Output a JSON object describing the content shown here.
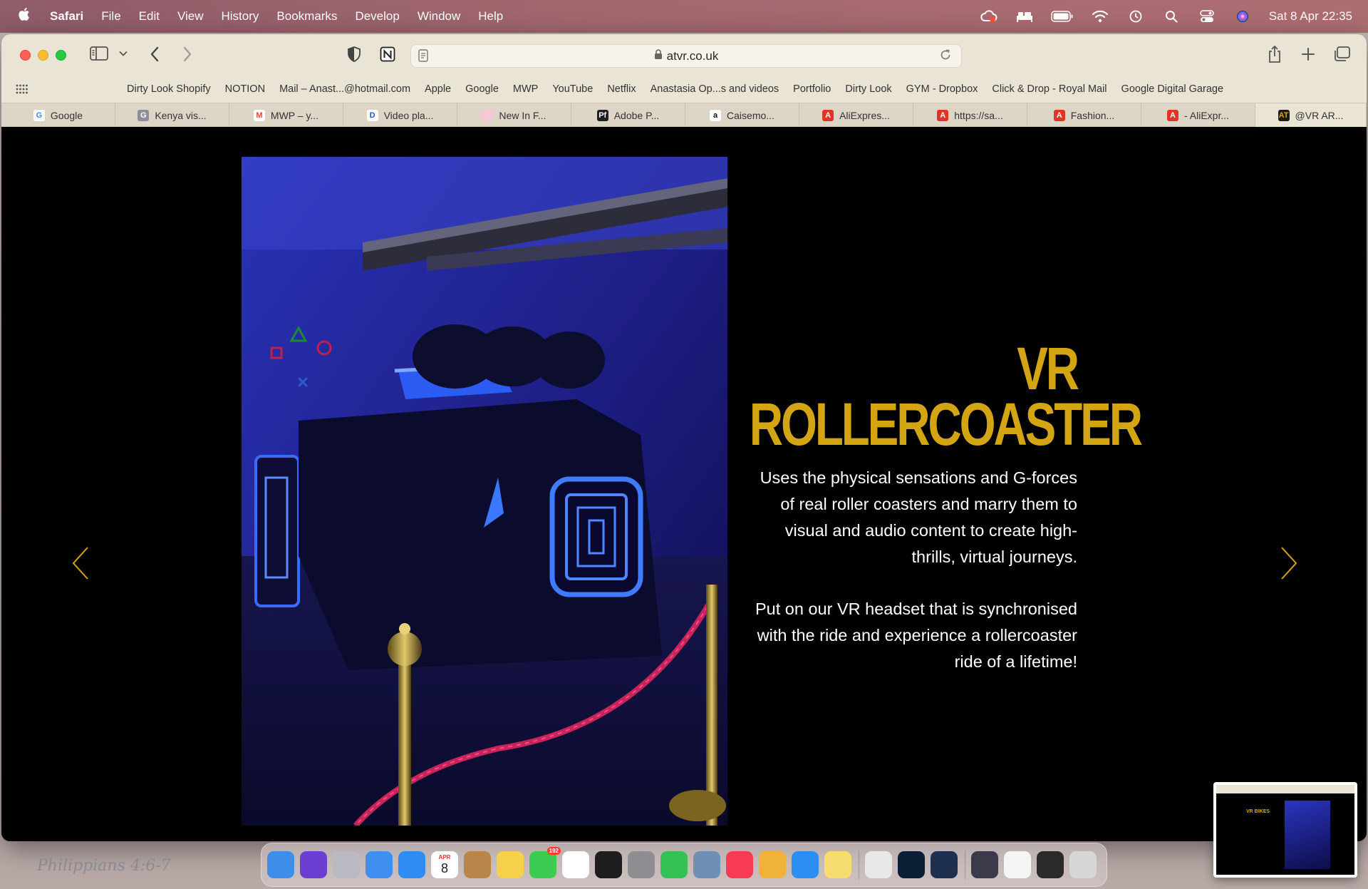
{
  "menubar": {
    "app_name": "Safari",
    "items": [
      "File",
      "Edit",
      "View",
      "History",
      "Bookmarks",
      "Develop",
      "Window",
      "Help"
    ],
    "clock": "Sat 8 Apr  22:35"
  },
  "toolbar": {
    "url": "atvr.co.uk"
  },
  "favorites": [
    "Dirty Look Shopify",
    "NOTION",
    "Mail – Anast...@hotmail.com",
    "Apple",
    "Google",
    "MWP",
    "YouTube",
    "Netflix",
    "Anastasia Op...s and videos",
    "Portfolio",
    "Dirty Look",
    "GYM - Dropbox",
    "Click & Drop - Royal Mail",
    "Google Digital Garage"
  ],
  "tabs": [
    {
      "label": "Google",
      "icon": "G",
      "color": "#ffffff",
      "text": "#4285f4"
    },
    {
      "label": "Kenya vis...",
      "icon": "G",
      "color": "#8e8e9a",
      "text": "#ffffff"
    },
    {
      "label": "MWP – y...",
      "icon": "M",
      "color": "#ffffff",
      "text": "#e0442c"
    },
    {
      "label": "Video pla...",
      "icon": "D",
      "color": "#ffffff",
      "text": "#2454c8"
    },
    {
      "label": "New In F...",
      "icon": "",
      "color": "#f6c6d9",
      "text": "#ffffff"
    },
    {
      "label": "Adobe P...",
      "icon": "Pf",
      "color": "#1e1e1e",
      "text": "#ffffff"
    },
    {
      "label": "Caisemo...",
      "icon": "a",
      "color": "#ffffff",
      "text": "#111111"
    },
    {
      "label": "AliExpres...",
      "icon": "A",
      "color": "#e43225",
      "text": "#ffffff"
    },
    {
      "label": "https://sa...",
      "icon": "A",
      "color": "#e43225",
      "text": "#ffffff"
    },
    {
      "label": "Fashion...",
      "icon": "A",
      "color": "#e43225",
      "text": "#ffffff"
    },
    {
      "label": "- AliExpr...",
      "icon": "A",
      "color": "#e43225",
      "text": "#ffffff"
    },
    {
      "label": "@VR AR...",
      "icon": "AT",
      "color": "#1b1b1b",
      "text": "#d4a513"
    }
  ],
  "page": {
    "title": "VR ROLLERCOASTER",
    "paragraph_1": "Uses the physical sensations and G-forces of real roller coasters and marry them to visual and audio content to create high-thrills, virtual journeys.",
    "paragraph_2": "Put on our VR headset that is synchronised with the ride and experience a rollercoaster ride of a lifetime!",
    "accent_color": "#d4a513"
  },
  "dock": {
    "calendar_month": "APR",
    "calendar_day": "8",
    "messages_badge": "192",
    "apps": [
      {
        "name": "finder-icon",
        "color": "#3d8ee8"
      },
      {
        "name": "siri-icon",
        "color": "#6a3fd1"
      },
      {
        "name": "launchpad-icon",
        "color": "#b9b9c4"
      },
      {
        "name": "mail-icon",
        "color": "#3f8ff0"
      },
      {
        "name": "safari-icon",
        "color": "#2f8cf0"
      },
      {
        "name": "calendar-icon",
        "color": "#ffffff"
      },
      {
        "name": "contacts-icon",
        "color": "#b8864b"
      },
      {
        "name": "notes-icon",
        "color": "#f5d14a"
      },
      {
        "name": "messages-icon",
        "color": "#3ccc54"
      },
      {
        "name": "reminders-icon",
        "color": "#ffffff"
      },
      {
        "name": "tidal-icon",
        "color": "#1d1d1d"
      },
      {
        "name": "system-settings-icon",
        "color": "#8d8d92"
      },
      {
        "name": "facetime-icon",
        "color": "#35c155"
      },
      {
        "name": "preview-icon",
        "color": "#6f8fb5"
      },
      {
        "name": "music-icon",
        "color": "#f83b52"
      },
      {
        "name": "photos-icon",
        "color": "#f2b33a"
      },
      {
        "name": "app-store-icon",
        "color": "#2c8df2"
      },
      {
        "name": "stickies-icon",
        "color": "#f7dc6f"
      }
    ],
    "apps_2": [
      {
        "name": "chrome-icon",
        "color": "#e8e8e8"
      },
      {
        "name": "photoshop-icon",
        "color": "#0b1e36"
      },
      {
        "name": "quicktime-icon",
        "color": "#1f2f4e"
      }
    ],
    "minimized": [
      {
        "name": "minimized-window-1",
        "color": "#3a3a4a"
      },
      {
        "name": "minimized-window-2",
        "color": "#f4f4f4"
      },
      {
        "name": "minimized-window-3",
        "color": "#2a2a2a"
      },
      {
        "name": "trash-icon",
        "color": "#d6d6d6"
      }
    ]
  },
  "desktop": {
    "note": "Philippians 4:6-7"
  },
  "thumbnail": {
    "title": "VR BIKES"
  }
}
